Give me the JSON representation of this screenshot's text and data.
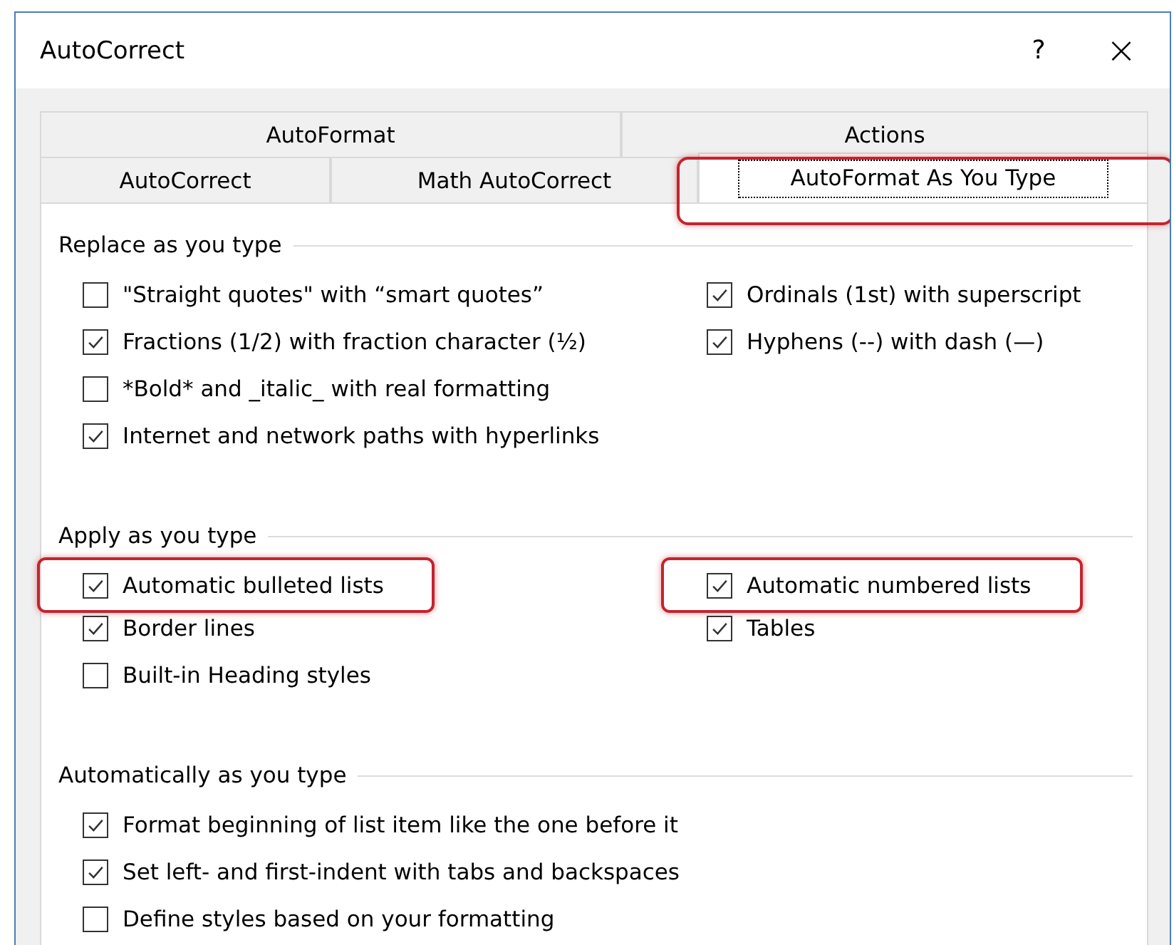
{
  "window": {
    "title": "AutoCorrect",
    "help_button": "?",
    "close_button": "×"
  },
  "tab_rows": [
    [
      {
        "label": "AutoFormat",
        "selected": false,
        "highlighted": false
      },
      {
        "label": "Actions",
        "selected": false,
        "highlighted": false
      }
    ],
    [
      {
        "label": "AutoCorrect",
        "selected": false,
        "highlighted": false
      },
      {
        "label": "Math AutoCorrect",
        "selected": false,
        "highlighted": false
      },
      {
        "label": "AutoFormat As You Type",
        "selected": true,
        "highlighted": true
      }
    ]
  ],
  "sections": [
    {
      "title": "Replace as you type",
      "columns": [
        [
          {
            "label": "\"Straight quotes\" with “smart quotes”",
            "checked": false,
            "highlighted": false
          },
          {
            "label": "Fractions (1/2) with fraction character (½)",
            "checked": true,
            "highlighted": false
          },
          {
            "label": "*Bold* and _italic_ with real formatting",
            "checked": false,
            "highlighted": false
          },
          {
            "label": "Internet and network paths with hyperlinks",
            "checked": true,
            "highlighted": false
          }
        ],
        [
          {
            "label": "Ordinals (1st) with superscript",
            "checked": true,
            "highlighted": false
          },
          {
            "label": "Hyphens (--) with dash (—)",
            "checked": true,
            "highlighted": false
          }
        ]
      ]
    },
    {
      "title": "Apply as you type",
      "columns": [
        [
          {
            "label": "Automatic bulleted lists",
            "checked": true,
            "highlighted": true
          },
          {
            "label": "Border lines",
            "checked": true,
            "highlighted": false
          },
          {
            "label": "Built-in Heading styles",
            "checked": false,
            "highlighted": false
          }
        ],
        [
          {
            "label": "Automatic numbered lists",
            "checked": true,
            "highlighted": true
          },
          {
            "label": "Tables",
            "checked": true,
            "highlighted": false
          }
        ]
      ]
    },
    {
      "title": "Automatically as you type",
      "columns": [
        [
          {
            "label": "Format beginning of list item like the one before it",
            "checked": true,
            "highlighted": false
          },
          {
            "label": "Set left- and first-indent with tabs and backspaces",
            "checked": true,
            "highlighted": false
          },
          {
            "label": "Define styles based on your formatting",
            "checked": false,
            "highlighted": false
          }
        ],
        []
      ]
    }
  ]
}
